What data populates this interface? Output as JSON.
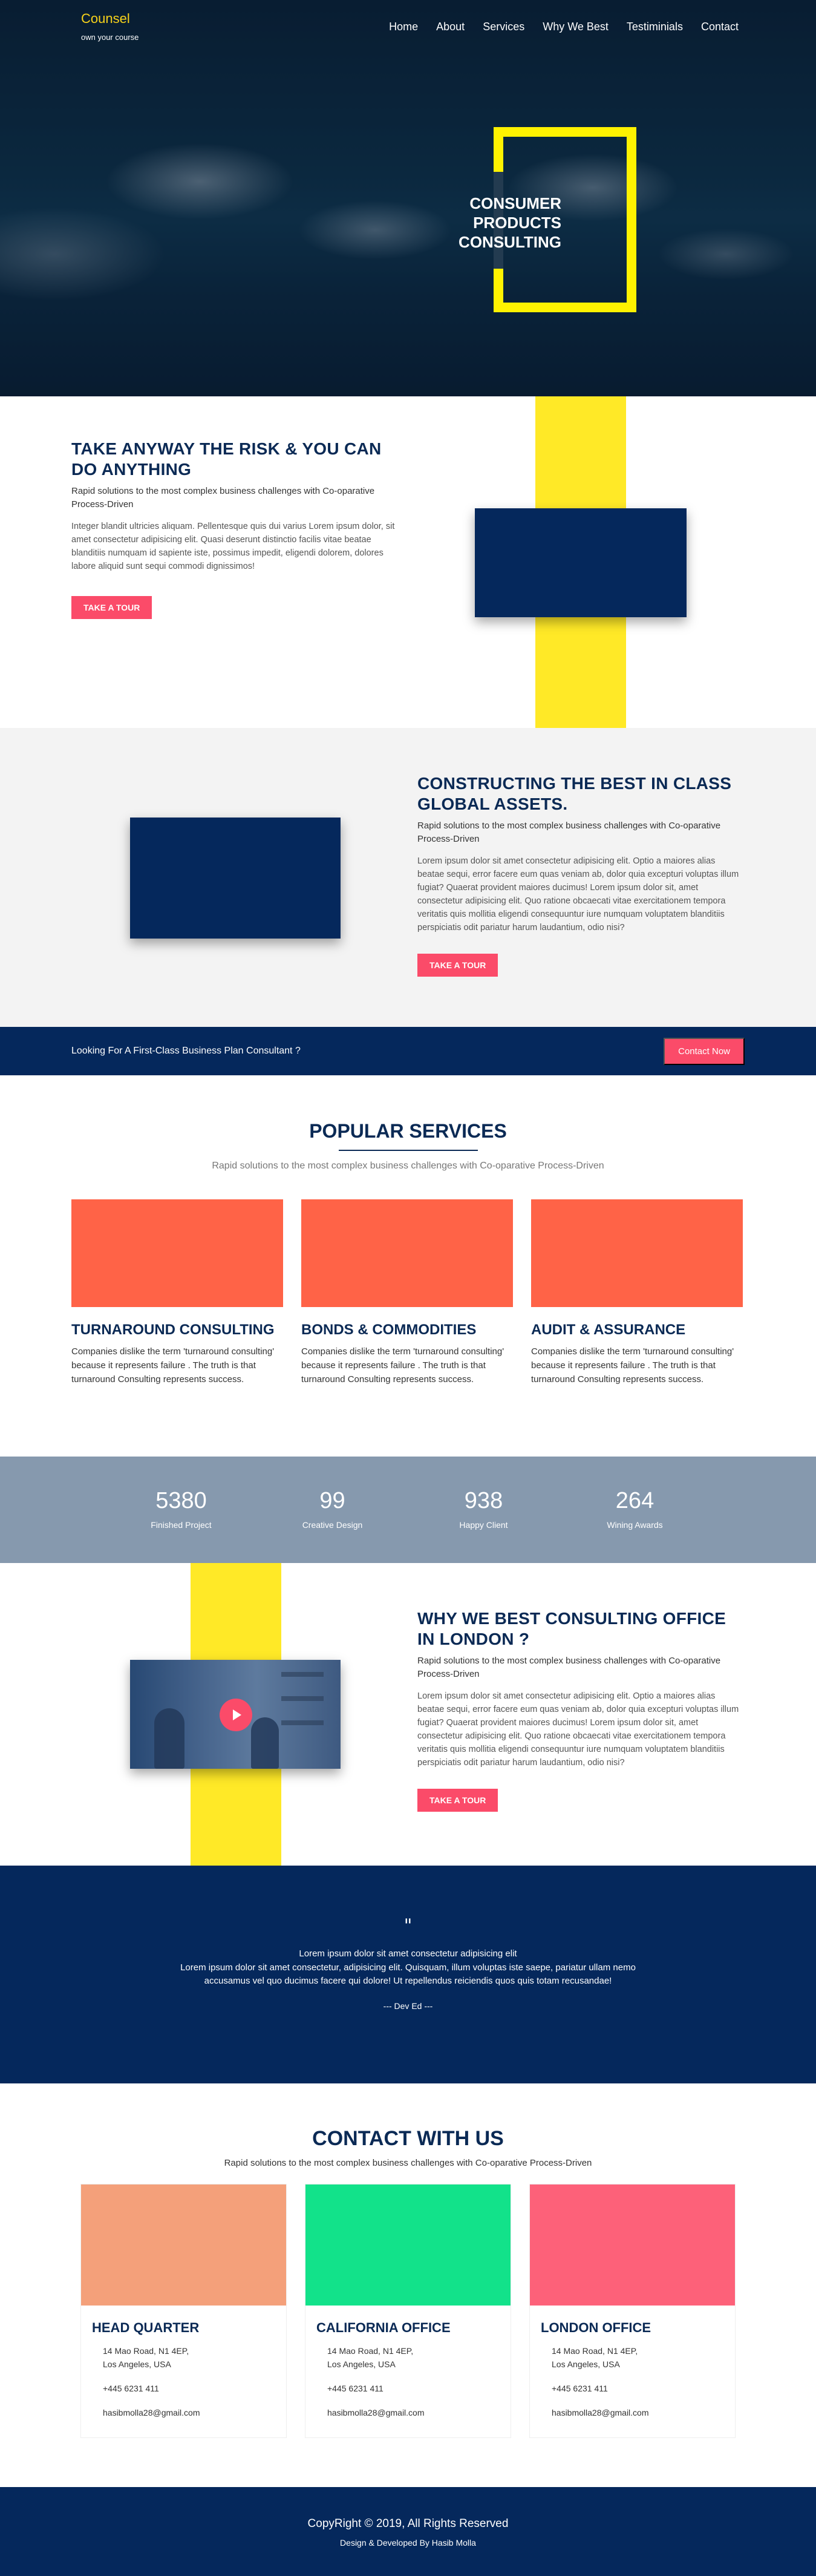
{
  "brand": {
    "name": "Counsel",
    "tagline": "own your course"
  },
  "nav": {
    "items": [
      "Home",
      "About",
      "Services",
      "Why We Best",
      "Testiminials",
      "Contact"
    ]
  },
  "hero": {
    "title": "CONSUMER PRODUCTS CONSULTING"
  },
  "about": {
    "title": "TAKE ANYWAY THE RISK & YOU CAN DO ANYTHING",
    "subtitle": "Rapid solutions to the most complex business challenges with Co-oparative Process-Driven",
    "body": "Integer blandit ultricies aliquam. Pellentesque quis dui varius Lorem ipsum dolor, sit amet consectetur adipisicing elit. Quasi deserunt distinctio facilis vitae beatae blanditiis numquam id sapiente iste, possimus impedit, eligendi dolorem, dolores labore aliquid sunt sequi commodi dignissimos!",
    "button": "TAKE A TOUR"
  },
  "construct": {
    "title": "CONSTRUCTING THE BEST IN CLASS GLOBAL ASSETS.",
    "subtitle": "Rapid solutions to the most complex business challenges with Co-oparative Process-Driven",
    "body": "Lorem ipsum dolor sit amet consectetur adipisicing elit. Optio a maiores alias beatae sequi, error facere eum quas veniam ab, dolor quia excepturi voluptas illum fugiat? Quaerat provident maiores ducimus! Lorem ipsum dolor sit, amet consectetur adipisicing elit. Quo ratione obcaecati vitae exercitationem tempora veritatis quis mollitia eligendi consequuntur iure numquam voluptatem blanditiis perspiciatis odit pariatur harum laudantium, odio nisi?",
    "button": "TAKE A TOUR"
  },
  "cta": {
    "text": "Looking For A First-Class Business Plan Consultant ?",
    "button": "Contact Now"
  },
  "services": {
    "title": "POPULAR SERVICES",
    "subtitle": "Rapid solutions to the most complex business challenges with Co-oparative Process-Driven",
    "items": [
      {
        "title": "TURNAROUND CONSULTING",
        "desc": "Companies dislike the term 'turnaround consulting' because it represents failure . The truth is that turnaround Consulting represents success."
      },
      {
        "title": "BONDS & COMMODITIES",
        "desc": "Companies dislike the term 'turnaround consulting' because it represents failure . The truth is that turnaround Consulting represents success."
      },
      {
        "title": "AUDIT & ASSURANCE",
        "desc": "Companies dislike the term 'turnaround consulting' because it represents failure . The truth is that turnaround Consulting represents success."
      }
    ],
    "image_color": "#ff6347"
  },
  "stats": {
    "items": [
      {
        "num": "5380",
        "label": "Finished Project"
      },
      {
        "num": "99",
        "label": "Creative Design"
      },
      {
        "num": "938",
        "label": "Happy Client"
      },
      {
        "num": "264",
        "label": "Wining Awards"
      }
    ]
  },
  "why": {
    "title": "WHY WE BEST CONSULTING OFFICE IN LONDON ?",
    "subtitle": "Rapid solutions to the most complex business challenges with Co-oparative Process-Driven",
    "body": "Lorem ipsum dolor sit amet consectetur adipisicing elit. Optio a maiores alias beatae sequi, error facere eum quas veniam ab, dolor quia excepturi voluptas illum fugiat? Quaerat provident maiores ducimus! Lorem ipsum dolor sit, amet consectetur adipisicing elit. Quo ratione obcaecati vitae exercitationem tempora veritatis quis mollitia eligendi consequuntur iure numquam voluptatem blanditiis perspiciatis odit pariatur harum laudantium, odio nisi?",
    "button": "TAKE A TOUR"
  },
  "testimonial": {
    "mark": "\"",
    "lead": "Lorem ipsum dolor sit amet consectetur adipisicing elit",
    "body": "Lorem ipsum dolor sit amet consectetur, adipisicing elit. Quisquam, illum voluptas iste saepe, pariatur ullam nemo accusamus vel quo ducimus facere qui dolore! Ut repellendus reiciendis quos quis totam recusandae!",
    "author": "--- Dev Ed ---"
  },
  "contact": {
    "title": "CONTACT WITH US",
    "subtitle": "Rapid solutions to the most complex business challenges with Co-oparative Process-Driven",
    "offices": [
      {
        "title": "HEAD QUARTER",
        "addr1": "14 Mao Road, N1 4EP,",
        "addr2": "Los Angeles, USA",
        "phone": "+445 6231 411",
        "email": "hasibmolla28@gmail.com",
        "color": "#f4a07a"
      },
      {
        "title": "CALIFORNIA OFFICE",
        "addr1": "14 Mao Road, N1 4EP,",
        "addr2": "Los Angeles, USA",
        "phone": "+445 6231 411",
        "email": "hasibmolla28@gmail.com",
        "color": "#12e28a"
      },
      {
        "title": "LONDON OFFICE",
        "addr1": "14 Mao Road, N1 4EP,",
        "addr2": "Los Angeles, USA",
        "phone": "+445 6231 411",
        "email": "hasibmolla28@gmail.com",
        "color": "#fd6179"
      }
    ]
  },
  "footer": {
    "copyright": "CopyRight © 2019, All Rights Reserved",
    "developer": "Design & Developed By Hasib Molla"
  },
  "colors": {
    "navy": "#05285c",
    "accent_yellow": "#ffe927",
    "button_pink": "#fb4b69",
    "brand_yellow": "#f7d21a",
    "stats_bg": "#8699ae"
  }
}
